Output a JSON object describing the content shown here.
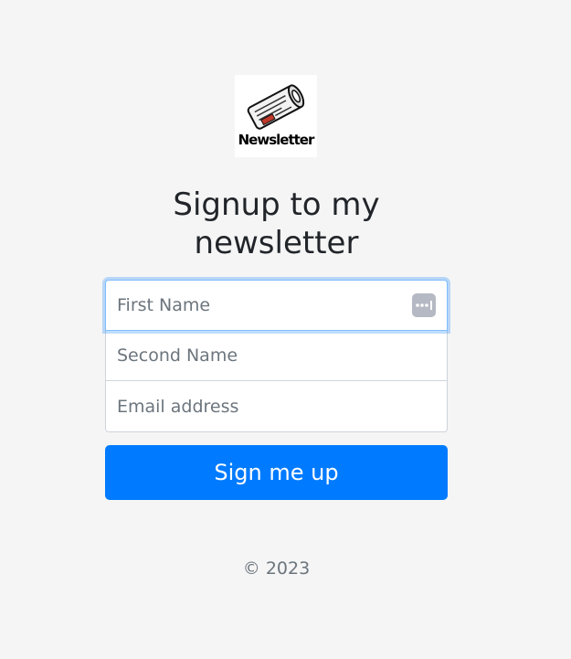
{
  "logo": {
    "text": "Newsletter",
    "icon": "newspaper-icon"
  },
  "heading": {
    "line1": "Signup to my",
    "line2": "newsletter"
  },
  "form": {
    "first_name_placeholder": "First Name",
    "second_name_placeholder": "Second Name",
    "email_placeholder": "Email address",
    "submit_label": "Sign me up"
  },
  "footer": {
    "copyright": "© 2023"
  },
  "colors": {
    "background": "#f5f5f5",
    "primary_button": "#007bff",
    "focus_border": "#80bdff",
    "placeholder_text": "#6c757d"
  }
}
